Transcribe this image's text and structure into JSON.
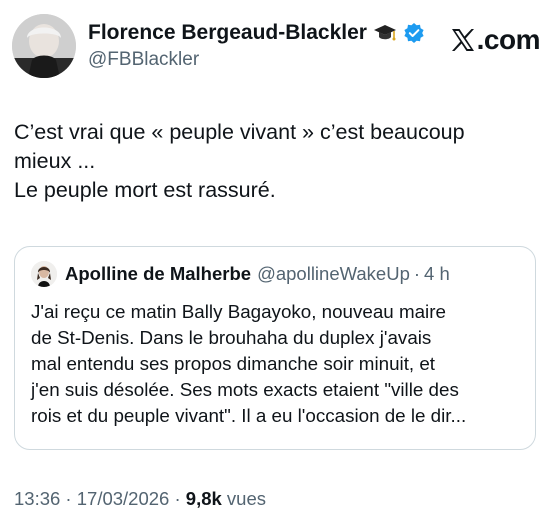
{
  "author": {
    "display_name": "Florence Bergeaud-Blackler",
    "handle": "@FBBlackler",
    "badges": [
      "graduation-cap-icon",
      "verified-badge-icon"
    ],
    "verified_color": "#1d9bf0"
  },
  "brand": {
    "label": ".com",
    "icon": "x-logo-icon"
  },
  "tweet": {
    "lines": [
      "C’est vrai que « peuple vivant » c’est beaucoup",
      "mieux ...",
      "Le peuple mort est rassuré."
    ]
  },
  "quote": {
    "display_name": "Apolline de Malherbe",
    "handle": "@apollineWakeUp",
    "separator": "·",
    "time": "4 h",
    "lines": [
      "J'ai reçu ce matin Bally Bagayoko, nouveau maire",
      "de St-Denis. Dans le brouhaha du duplex j'avais",
      "mal entendu ses propos dimanche soir minuit, et",
      "j'en suis désolée. Ses mots exacts etaient \"ville des",
      "rois et du peuple vivant\". Il a eu l'occasion de le dir..."
    ]
  },
  "meta": {
    "time": "13:36 · 17/03/2026 · ",
    "views_count": "9,8k",
    "views_label": " vues"
  },
  "colors": {
    "text": "#0f1419",
    "secondary": "#536471",
    "border": "#cfd9de"
  }
}
